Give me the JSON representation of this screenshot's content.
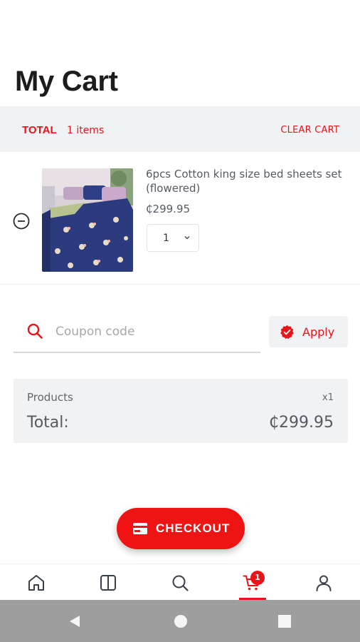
{
  "page": {
    "title": "My Cart"
  },
  "cart_header": {
    "total_label": "TOTAL",
    "item_count": "1 items",
    "clear_label": "CLEAR CART"
  },
  "items": [
    {
      "name": "6pcs Cotton king size bed sheets set (flowered)",
      "price": "₵299.95",
      "quantity": "1",
      "remove_icon": "minus-circle-icon"
    }
  ],
  "coupon": {
    "placeholder": "Coupon code",
    "value": "",
    "apply_label": "Apply"
  },
  "summary": {
    "products_label": "Products",
    "products_count": "x1",
    "total_label": "Total:",
    "total_value": "₵299.95"
  },
  "checkout": {
    "label": "CHECKOUT",
    "icon": "credit-card-icon"
  },
  "bottom_nav": {
    "items": [
      {
        "icon": "home-icon",
        "active": false
      },
      {
        "icon": "catalog-icon",
        "active": false
      },
      {
        "icon": "search-icon",
        "active": false
      },
      {
        "icon": "cart-icon",
        "active": true,
        "badge": "1"
      },
      {
        "icon": "profile-icon",
        "active": false
      }
    ]
  },
  "colors": {
    "accent": "#e8141a",
    "checkout": "#ef1414",
    "panel": "#f0f2f4",
    "system_bar": "#9e9e9e"
  }
}
